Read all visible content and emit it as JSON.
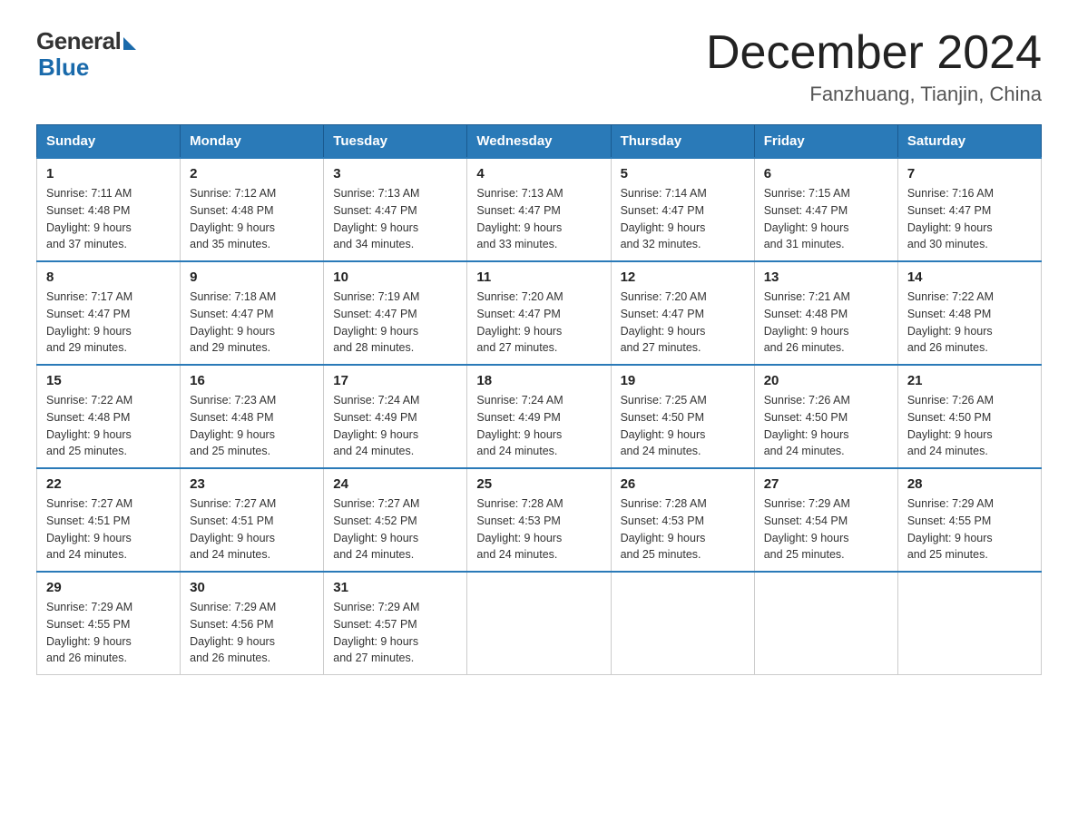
{
  "logo": {
    "general": "General",
    "blue": "Blue"
  },
  "title": {
    "month": "December 2024",
    "location": "Fanzhuang, Tianjin, China"
  },
  "headers": [
    "Sunday",
    "Monday",
    "Tuesday",
    "Wednesday",
    "Thursday",
    "Friday",
    "Saturday"
  ],
  "weeks": [
    [
      {
        "day": "1",
        "sunrise": "7:11 AM",
        "sunset": "4:48 PM",
        "daylight": "9 hours and 37 minutes."
      },
      {
        "day": "2",
        "sunrise": "7:12 AM",
        "sunset": "4:48 PM",
        "daylight": "9 hours and 35 minutes."
      },
      {
        "day": "3",
        "sunrise": "7:13 AM",
        "sunset": "4:47 PM",
        "daylight": "9 hours and 34 minutes."
      },
      {
        "day": "4",
        "sunrise": "7:13 AM",
        "sunset": "4:47 PM",
        "daylight": "9 hours and 33 minutes."
      },
      {
        "day": "5",
        "sunrise": "7:14 AM",
        "sunset": "4:47 PM",
        "daylight": "9 hours and 32 minutes."
      },
      {
        "day": "6",
        "sunrise": "7:15 AM",
        "sunset": "4:47 PM",
        "daylight": "9 hours and 31 minutes."
      },
      {
        "day": "7",
        "sunrise": "7:16 AM",
        "sunset": "4:47 PM",
        "daylight": "9 hours and 30 minutes."
      }
    ],
    [
      {
        "day": "8",
        "sunrise": "7:17 AM",
        "sunset": "4:47 PM",
        "daylight": "9 hours and 29 minutes."
      },
      {
        "day": "9",
        "sunrise": "7:18 AM",
        "sunset": "4:47 PM",
        "daylight": "9 hours and 29 minutes."
      },
      {
        "day": "10",
        "sunrise": "7:19 AM",
        "sunset": "4:47 PM",
        "daylight": "9 hours and 28 minutes."
      },
      {
        "day": "11",
        "sunrise": "7:20 AM",
        "sunset": "4:47 PM",
        "daylight": "9 hours and 27 minutes."
      },
      {
        "day": "12",
        "sunrise": "7:20 AM",
        "sunset": "4:47 PM",
        "daylight": "9 hours and 27 minutes."
      },
      {
        "day": "13",
        "sunrise": "7:21 AM",
        "sunset": "4:48 PM",
        "daylight": "9 hours and 26 minutes."
      },
      {
        "day": "14",
        "sunrise": "7:22 AM",
        "sunset": "4:48 PM",
        "daylight": "9 hours and 26 minutes."
      }
    ],
    [
      {
        "day": "15",
        "sunrise": "7:22 AM",
        "sunset": "4:48 PM",
        "daylight": "9 hours and 25 minutes."
      },
      {
        "day": "16",
        "sunrise": "7:23 AM",
        "sunset": "4:48 PM",
        "daylight": "9 hours and 25 minutes."
      },
      {
        "day": "17",
        "sunrise": "7:24 AM",
        "sunset": "4:49 PM",
        "daylight": "9 hours and 24 minutes."
      },
      {
        "day": "18",
        "sunrise": "7:24 AM",
        "sunset": "4:49 PM",
        "daylight": "9 hours and 24 minutes."
      },
      {
        "day": "19",
        "sunrise": "7:25 AM",
        "sunset": "4:50 PM",
        "daylight": "9 hours and 24 minutes."
      },
      {
        "day": "20",
        "sunrise": "7:26 AM",
        "sunset": "4:50 PM",
        "daylight": "9 hours and 24 minutes."
      },
      {
        "day": "21",
        "sunrise": "7:26 AM",
        "sunset": "4:50 PM",
        "daylight": "9 hours and 24 minutes."
      }
    ],
    [
      {
        "day": "22",
        "sunrise": "7:27 AM",
        "sunset": "4:51 PM",
        "daylight": "9 hours and 24 minutes."
      },
      {
        "day": "23",
        "sunrise": "7:27 AM",
        "sunset": "4:51 PM",
        "daylight": "9 hours and 24 minutes."
      },
      {
        "day": "24",
        "sunrise": "7:27 AM",
        "sunset": "4:52 PM",
        "daylight": "9 hours and 24 minutes."
      },
      {
        "day": "25",
        "sunrise": "7:28 AM",
        "sunset": "4:53 PM",
        "daylight": "9 hours and 24 minutes."
      },
      {
        "day": "26",
        "sunrise": "7:28 AM",
        "sunset": "4:53 PM",
        "daylight": "9 hours and 25 minutes."
      },
      {
        "day": "27",
        "sunrise": "7:29 AM",
        "sunset": "4:54 PM",
        "daylight": "9 hours and 25 minutes."
      },
      {
        "day": "28",
        "sunrise": "7:29 AM",
        "sunset": "4:55 PM",
        "daylight": "9 hours and 25 minutes."
      }
    ],
    [
      {
        "day": "29",
        "sunrise": "7:29 AM",
        "sunset": "4:55 PM",
        "daylight": "9 hours and 26 minutes."
      },
      {
        "day": "30",
        "sunrise": "7:29 AM",
        "sunset": "4:56 PM",
        "daylight": "9 hours and 26 minutes."
      },
      {
        "day": "31",
        "sunrise": "7:29 AM",
        "sunset": "4:57 PM",
        "daylight": "9 hours and 27 minutes."
      },
      null,
      null,
      null,
      null
    ]
  ],
  "labels": {
    "sunrise": "Sunrise:",
    "sunset": "Sunset:",
    "daylight": "Daylight:"
  }
}
